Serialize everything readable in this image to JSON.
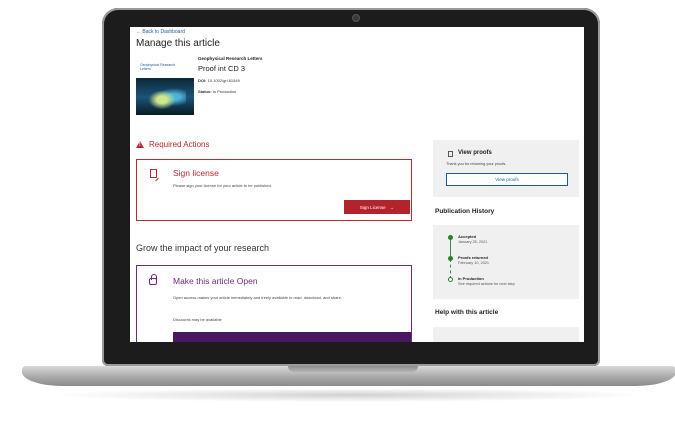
{
  "nav": {
    "back_label": "← Back to Dashboard"
  },
  "article": {
    "page_title": "Manage this article",
    "cover_label": "Geophysical Research Letters",
    "journal": "Geophysical Research Letters",
    "title": "Proof int CD 3",
    "doi_label": "DOI:",
    "doi_value": "10.1002/grl.61549",
    "status_label": "Status:",
    "status_value": "In Production"
  },
  "required_actions": {
    "heading": "Required Actions",
    "sign_license": {
      "title": "Sign license",
      "description": "Please sign your license for your article to be published.",
      "button_label": "Sign License",
      "button_arrow": "→"
    }
  },
  "grow": {
    "heading": "Grow the impact of your research",
    "open_access": {
      "title": "Make this article Open",
      "description": "Open access makes your article immediately and freely available to read, download, and share.",
      "discount": "Discounts may be available"
    }
  },
  "view_proofs": {
    "title": "View proofs",
    "description": "Thank you for returning your proofs.",
    "button_label": "View proofs"
  },
  "publication_history": {
    "heading": "Publication History",
    "events": [
      {
        "title": "Accepted",
        "date": "January 25, 2021"
      },
      {
        "title": "Proofs returned",
        "date": "February 10, 2021"
      },
      {
        "title": "In Production",
        "date": "See required actions for next step"
      }
    ]
  },
  "help": {
    "heading": "Help with this article"
  },
  "colors": {
    "required": "#c0272d",
    "open_access": "#6b2a7a",
    "link": "#1a5b9a",
    "timeline": "#2e7d32"
  }
}
